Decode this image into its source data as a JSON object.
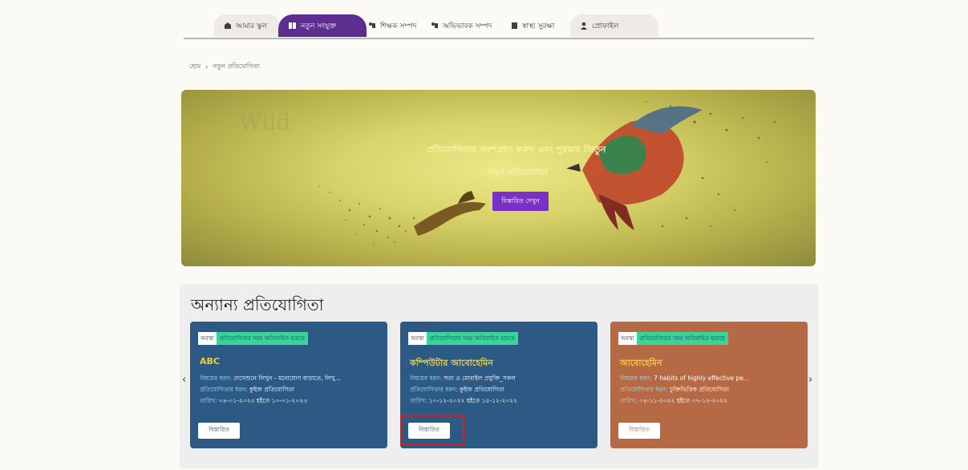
{
  "nav": {
    "tabs": [
      {
        "label": "আমার স্কুল",
        "icon": "school-icon",
        "active": false
      },
      {
        "label": "নতুন সংযুক্ত",
        "icon": "book-icon",
        "active": true
      },
      {
        "label": "শিক্ষক সম্পদ",
        "icon": "teacher-icon",
        "active": false
      },
      {
        "label": "অভিভাবক সম্পদ",
        "icon": "parent-icon",
        "active": false
      },
      {
        "label": "স্বাস্থ্য সুরক্ষা",
        "icon": "health-icon",
        "active": false
      },
      {
        "label": "প্রোফাইল",
        "icon": "profile-icon",
        "active": false
      }
    ]
  },
  "breadcrumb": {
    "home": "হোম",
    "separator": "›",
    "current": "নতুন প্রতিযোগিতা"
  },
  "banner": {
    "watermark": "Wild",
    "headline": "প্রতিযোগিতায় অংশগ্রহণ করুন এবং পুরস্কার জিতুন",
    "subline": "নতুন প্রতিযোগিতা",
    "button": "বিস্তারিত দেখুন"
  },
  "others": {
    "title": "অন্যান্য প্রতিযোগিতা",
    "prev_arrow": "‹",
    "next_arrow": "›",
    "cards": [
      {
        "tag": "অবস্থা",
        "status": "প্রতিযোগিতার সময় অতিবাহিত হয়েছে",
        "name": "ABC",
        "lines": [
          [
            "বিষয়ের ধরন:",
            "দেখেশুনে লিখুন - মনোযোগ বাড়াতে, লিখু..."
          ],
          [
            "প্রতিযোগিতার ধরন:",
            "কুইজ প্রতিযোগিতা"
          ],
          [
            "তারিখ:",
            "০৪-০১-২০২৩ হইতে ১০-০১-২০২৩"
          ]
        ],
        "button": "বিস্তারিত",
        "color": "#2d5a84"
      },
      {
        "tag": "অবস্থা",
        "status": "প্রতিযোগিতার সময় অতিবাহিত হয়েছে",
        "name": "কম্পিউটার আবোহেমিন",
        "lines": [
          [
            "বিষয়ের ধরন:",
            "সত্য ও মোবাইল প্রযুক্তি_সকল"
          ],
          [
            "প্রতিযোগিতার ধরন:",
            "কুইজ প্রতিযোগিতা"
          ],
          [
            "তারিখ:",
            "১০-১২-২০২২ হইতে ১৫-১২-২০২২"
          ]
        ],
        "button": "বিস্তারিত",
        "color": "#2d5a84"
      },
      {
        "tag": "অবস্থা",
        "status": "প্রতিযোগিতার সময় অতিবাহিত হয়েছে",
        "name": "আবোহেমিন",
        "lines": [
          [
            "বিষয়ের ধরন:",
            "7 habits of highly effective pe..."
          ],
          [
            "প্রতিযোগিতার ধরন:",
            "চুক্তিভিত্তিক প্রতিযোগিতা"
          ],
          [
            "তারিখ:",
            "০৪-১১-২০২২ হইতে ০৭-১২-২০২২"
          ]
        ],
        "button": "বিস্তারিত",
        "color": "#b56a45"
      }
    ]
  }
}
